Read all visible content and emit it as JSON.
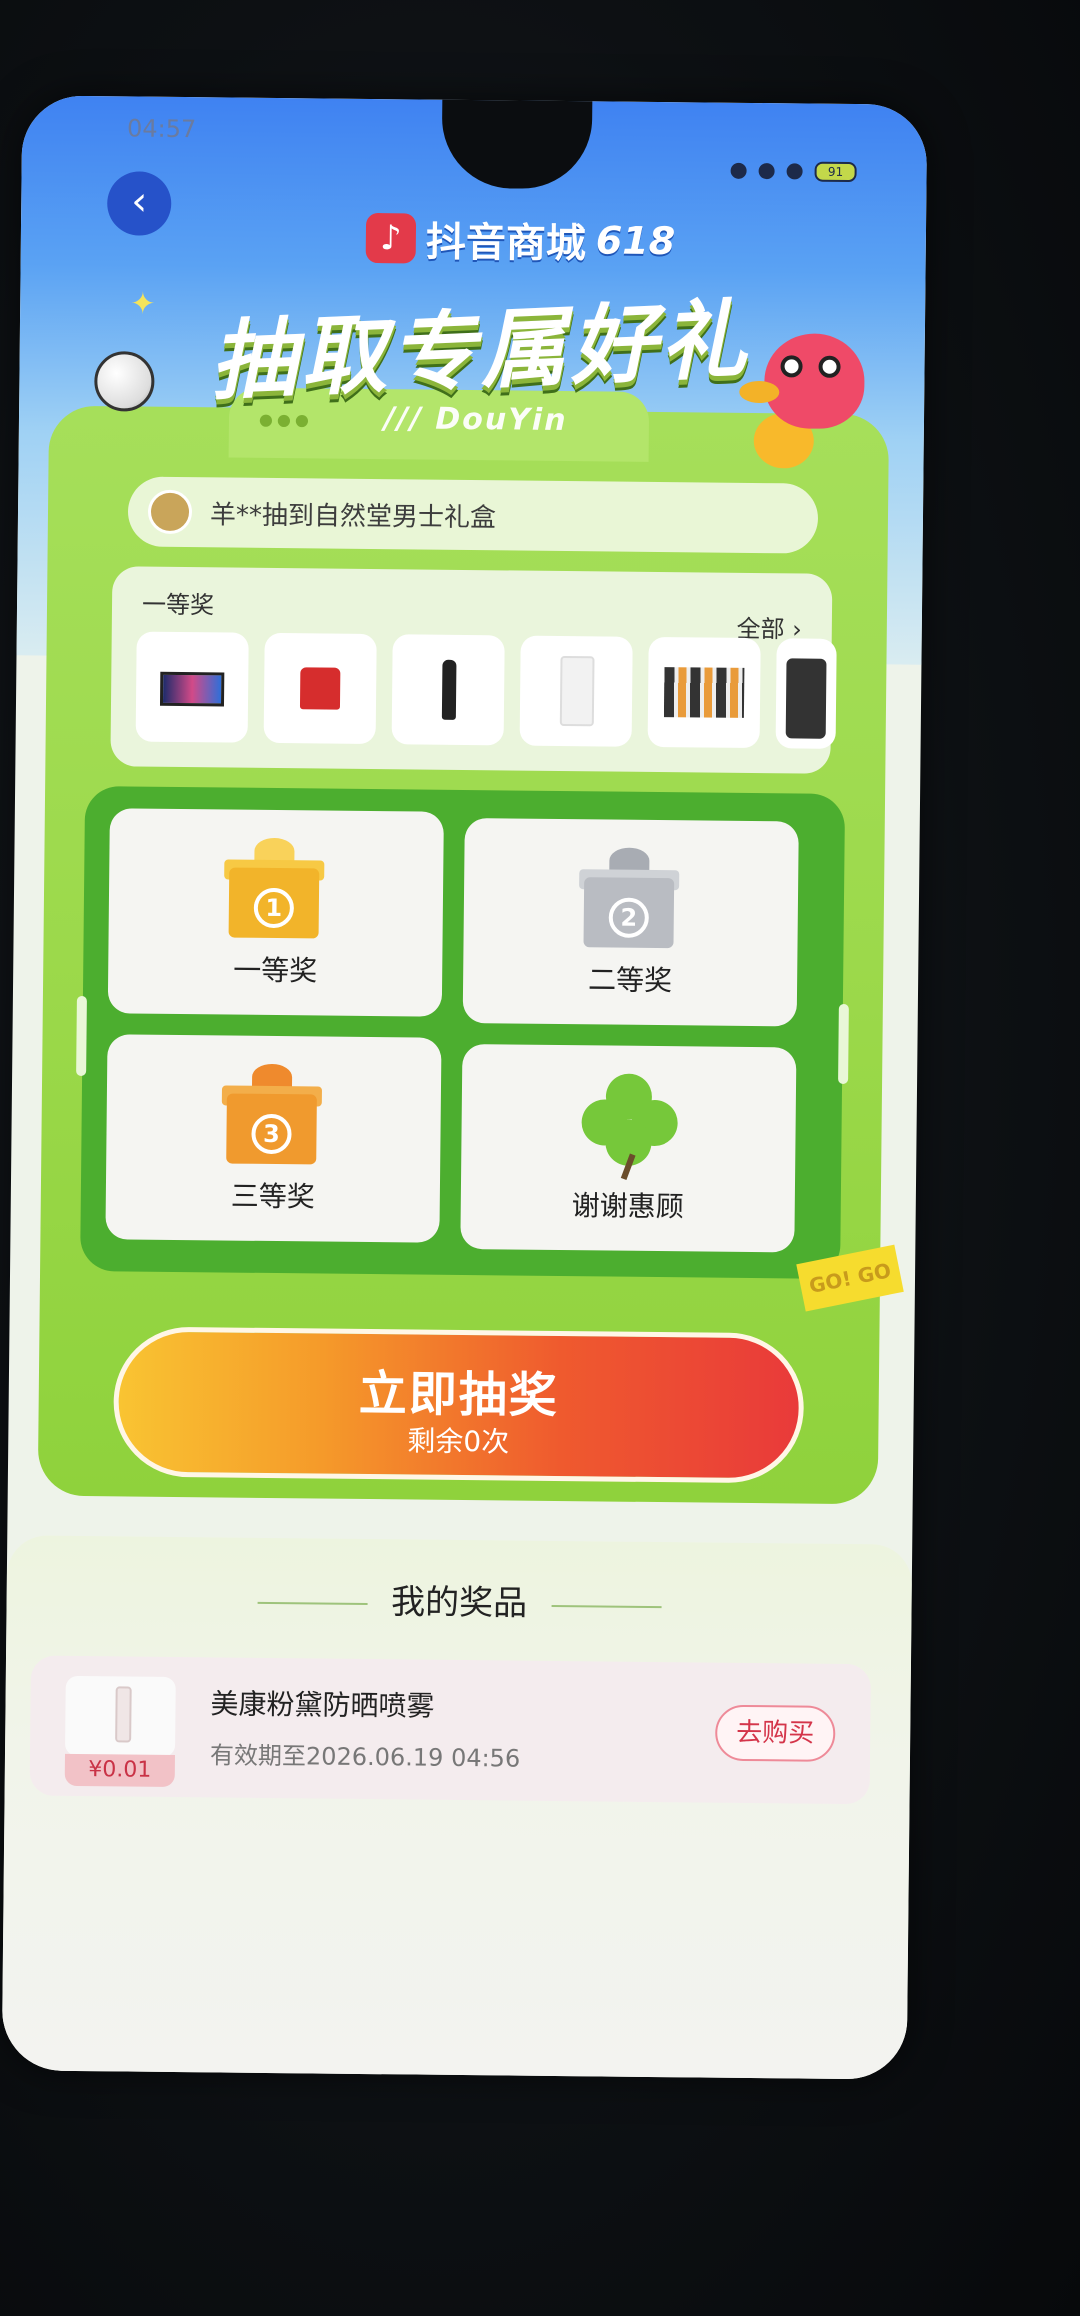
{
  "status_bar": {
    "time": "04:57",
    "battery": "91"
  },
  "header": {
    "back_icon": "chevron-left-icon",
    "brand_name": "抖音商城",
    "brand_suffix": "618",
    "headline": "抽取专属好礼"
  },
  "card": {
    "tab_text": "/// DouYin",
    "ticker": "羊**抽到自然堂男士礼盒",
    "prize_row_label": "一等奖",
    "prize_row_all": "全部 ›"
  },
  "grid": {
    "cells": [
      {
        "label": "一等奖",
        "num": "1"
      },
      {
        "label": "二等奖",
        "num": "2"
      },
      {
        "label": "三等奖",
        "num": "3"
      },
      {
        "label": "谢谢惠顾"
      }
    ],
    "tag": "GO! GO"
  },
  "draw_button": {
    "title": "立即抽奖",
    "subtitle": "剩余0次"
  },
  "my_prizes": {
    "title": "我的奖品",
    "items": [
      {
        "name": "美康粉黛防晒喷雾",
        "expiry": "有效期至2026.06.19 04:56",
        "price": "¥0.01",
        "action": "去购买"
      }
    ]
  }
}
